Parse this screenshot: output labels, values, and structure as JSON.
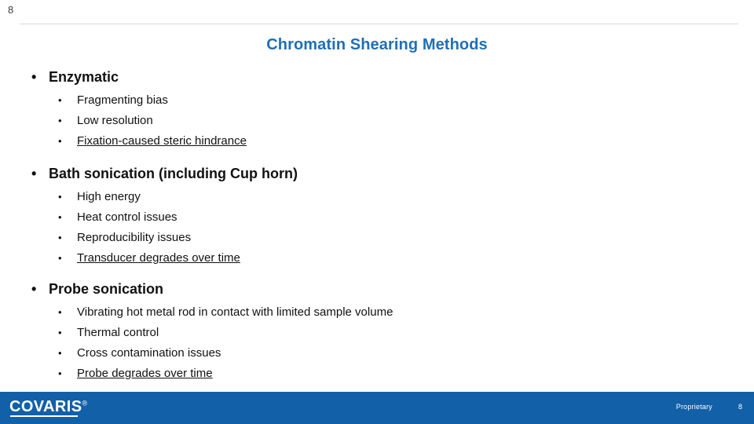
{
  "slide": {
    "corner_page_number": "8",
    "title": "Chromatin Shearing Methods"
  },
  "bullet_glyph": "•",
  "sections": [
    {
      "heading": "Enzymatic",
      "items": [
        {
          "text": "Fragmenting bias",
          "underline": false
        },
        {
          "text": "Low resolution",
          "underline": false
        },
        {
          "text": "Fixation-caused steric hindrance",
          "underline": true
        }
      ]
    },
    {
      "heading": "Bath sonication (including Cup horn)",
      "items": [
        {
          "text": "High energy",
          "underline": false
        },
        {
          "text": "Heat control issues",
          "underline": false
        },
        {
          "text": "Reproducibility issues",
          "underline": false
        },
        {
          "text": "Transducer degrades over time",
          "underline": true
        }
      ]
    },
    {
      "heading": "Probe sonication",
      "items": [
        {
          "text": "Vibrating hot metal rod in contact with limited sample volume",
          "underline": false
        },
        {
          "text": "Thermal control",
          "underline": false
        },
        {
          "text": "Cross contamination issues",
          "underline": false
        },
        {
          "text": "Probe degrades over time",
          "underline": true
        }
      ]
    }
  ],
  "footer": {
    "logo_text": "COVARIS",
    "logo_mark": "®",
    "proprietary_label": "Proprietary",
    "page_number": "8",
    "bar_color": "#1260a8"
  },
  "colors": {
    "title": "#1f6fb5",
    "text": "#111111",
    "rule": "#d9d9d9"
  }
}
